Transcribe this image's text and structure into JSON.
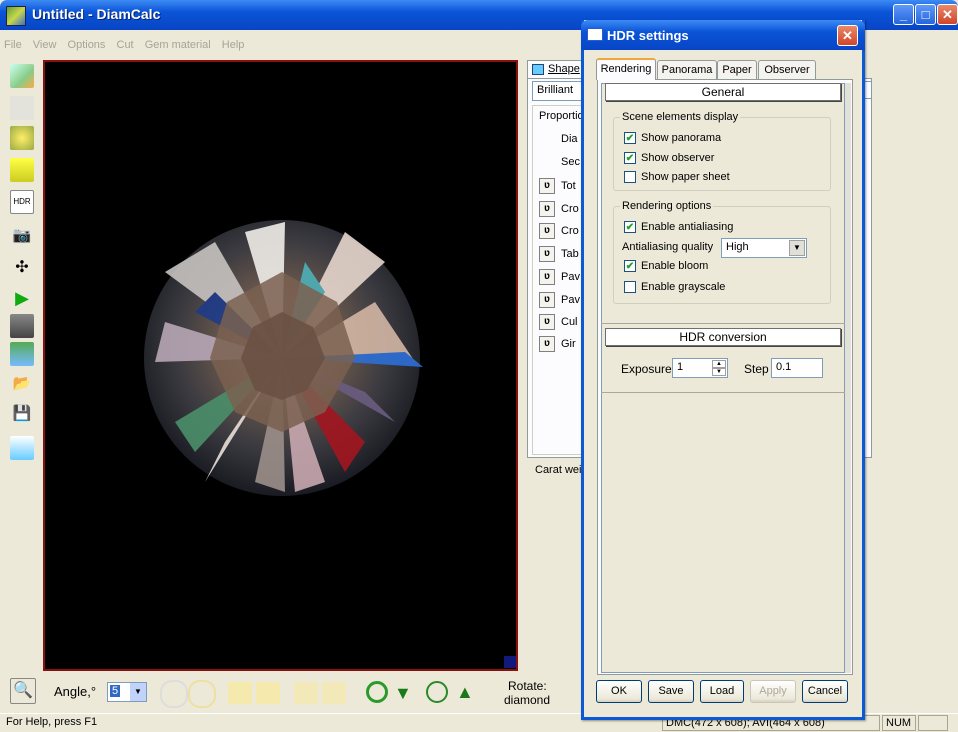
{
  "app": {
    "title": "Untitled - DiamCalc",
    "menu": [
      "File",
      "View",
      "Options",
      "Cut",
      "Gem material",
      "Help"
    ]
  },
  "left_toolbar": {
    "hdr_label": "HDR"
  },
  "right_panel": {
    "shape_tab": "Shape",
    "shape_value": "Brilliant",
    "proportions_label": "Proportio",
    "rows_plain": [
      "Dia",
      "Sec"
    ],
    "rows_param": [
      "Tot",
      "Cro",
      "Cro",
      "Tab",
      "Pav",
      "Pav",
      "Cul",
      "Gir"
    ],
    "carat_label": "Carat wei"
  },
  "bottom_bar": {
    "angle_label": "Angle,°",
    "angle_value": "5",
    "rotate_label": "Rotate:",
    "rotate_value": "diamond"
  },
  "statusbar": {
    "help": "For Help, press F1",
    "info": "DMC(472 x 608); AVI(464 x 608)",
    "num": "NUM"
  },
  "dialog": {
    "title": "HDR settings",
    "tabs": [
      "Rendering",
      "Panorama",
      "Paper",
      "Observer"
    ],
    "active_tab": "Rendering",
    "general_header": "General",
    "scene_group": {
      "label": "Scene elements display",
      "items": [
        {
          "label": "Show panorama",
          "checked": true
        },
        {
          "label": "Show observer",
          "checked": true
        },
        {
          "label": "Show paper sheet",
          "checked": false
        }
      ]
    },
    "render_group": {
      "label": "Rendering options",
      "antialiasing": {
        "label": "Enable antialiasing",
        "checked": true
      },
      "aa_quality_label": "Antialiasing quality",
      "aa_quality_value": "High",
      "bloom": {
        "label": "Enable bloom",
        "checked": true
      },
      "grayscale": {
        "label": "Enable grayscale",
        "checked": false
      }
    },
    "hdr_header": "HDR conversion",
    "exposure_label": "Exposure",
    "exposure_value": "1",
    "step_label": "Step",
    "step_value": "0.1",
    "buttons": {
      "ok": "OK",
      "save": "Save",
      "load": "Load",
      "apply": "Apply",
      "cancel": "Cancel"
    }
  },
  "colors": {
    "titlebar": "#0a54d8",
    "viewport_bg": "#000000",
    "viewport_border": "#8a1010",
    "dialog_border": "#0a5ad8"
  }
}
